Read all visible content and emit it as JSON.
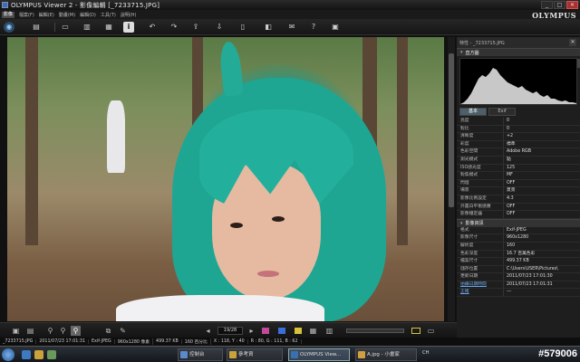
{
  "window": {
    "title": "OLYMPUS Viewer 2 - 影像編輯 [_7233715.JPG]"
  },
  "menu": {
    "mode_badge": "影像",
    "items": [
      "檔案(F)",
      "編輯(E)",
      "動畫(M)",
      "編輯(D)",
      "工具(T)",
      "說明(H)"
    ],
    "brand": "OLYMPUS"
  },
  "panel": {
    "file_header": "特性 - _7233715.JPG",
    "histogram_title": "直方圖",
    "tabs": [
      "基本",
      "Exif"
    ],
    "basic_rows": [
      {
        "k": "亮度",
        "v": "0"
      },
      {
        "k": "對比",
        "v": "0"
      },
      {
        "k": "清晰度",
        "v": "+2"
      },
      {
        "k": "彩度",
        "v": "標準"
      },
      {
        "k": "色彩空間",
        "v": "Adobe RGB"
      },
      {
        "k": "測光模式",
        "v": "點"
      },
      {
        "k": "ISO感光度",
        "v": "125"
      },
      {
        "k": "對焦模式",
        "v": "MF"
      },
      {
        "k": "閃燈",
        "v": "OFF"
      },
      {
        "k": "場景",
        "v": "夏景"
      },
      {
        "k": "影像比例設定",
        "v": "4:3"
      },
      {
        "k": "外置白平衡感應",
        "v": "OFF"
      },
      {
        "k": "影像穩定器",
        "v": "OFF"
      }
    ],
    "info_title": "影像資訊",
    "info_rows": [
      {
        "k": "格式",
        "v": "Exif-JPEG"
      },
      {
        "k": "影像尺寸",
        "v": "960x1280"
      },
      {
        "k": "解析度",
        "v": "160"
      },
      {
        "k": "色彩深度",
        "v": "16.7 百萬色彩"
      },
      {
        "k": "檔案尺寸",
        "v": "499.37 KB"
      },
      {
        "k": "儲存位置",
        "v": "C:\\Users\\USER\\Pictures\\"
      },
      {
        "k": "更新日期",
        "v": "2011/07/23 17:01:30"
      },
      {
        "k": "拍攝日期時間",
        "v": "2011/07/23 17:01:31"
      },
      {
        "k": "正確",
        "v": "---"
      }
    ]
  },
  "navbar": {
    "counter": "19/28"
  },
  "status": {
    "items": [
      "_7233715.JPG",
      "2011/07/23 17:01:31",
      "Exif-JPEG",
      "960x1280 像素",
      "499.37 KB",
      "160 百分比",
      "X : 118, Y : 40",
      "R : 80, G : 111, B : 62"
    ]
  },
  "taskbar": {
    "tasks": [
      "控制台",
      "參考資",
      "OLYMPUS View...",
      "A.jpg - 小畫家"
    ],
    "tray": "CH",
    "watermark": "#579006"
  },
  "colors": {
    "accent": "#4d5f6b",
    "link": "#6da7e8",
    "hair": "#1fa693"
  }
}
